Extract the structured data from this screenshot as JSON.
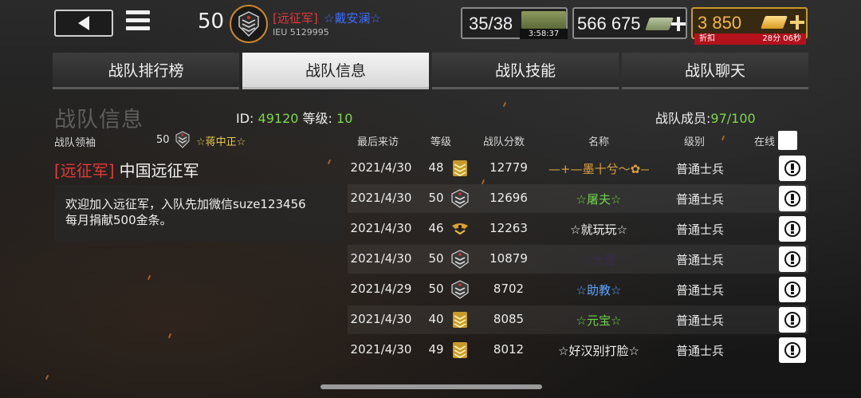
{
  "topbar": {
    "level": "50",
    "clan_tag": "[远征军]",
    "player_name": "☆戴安澜☆",
    "player_id": "IEU 5129995",
    "energy": "35/38",
    "energy_timer": "3:58:37",
    "silver": "566 675",
    "gold": "3 850",
    "discount_label": "折扣",
    "discount_time": "28分 06秒"
  },
  "tabs": [
    {
      "label": "战队排行榜"
    },
    {
      "label": "战队信息"
    },
    {
      "label": "战队技能"
    },
    {
      "label": "战队聊天"
    }
  ],
  "panel": {
    "section_title": "战队信息",
    "id_label": "ID:",
    "id_value": "49120",
    "level_label": "等级:",
    "level_value": "10",
    "members_label": "战队成员:",
    "members_value": "97/100",
    "leader_label": "战队领袖",
    "leader_level": "50",
    "leader_name": "☆蒋中正☆",
    "clan_tag": "[远征军]",
    "clan_name": "中国远征军",
    "notice_line1": "欢迎加入远征军，入队先加微信suze123456",
    "notice_line2": "每月捐献500金条。"
  },
  "table": {
    "headers": {
      "last_visit": "最后来访",
      "level": "等级",
      "score": "战队分数",
      "name": "名称",
      "rank": "级别",
      "online": "在线"
    },
    "rows": [
      {
        "date": "2021/4/30",
        "level": "48",
        "score": "12779",
        "name": "—+—墨十兮〜✿—☆",
        "role": "普通士兵",
        "name_color": "#d8a040",
        "rank_icon": "gold-chevron-icon"
      },
      {
        "date": "2021/4/30",
        "level": "50",
        "score": "12696",
        "name": "☆屠夫☆",
        "role": "普通士兵",
        "name_color": "#6fd24a",
        "rank_icon": "silver-star-icon"
      },
      {
        "date": "2021/4/30",
        "level": "46",
        "score": "12263",
        "name": "☆就玩玩☆",
        "role": "普通士兵",
        "name_color": "#f0f0f0",
        "rank_icon": "gold-eagle-icon"
      },
      {
        "date": "2021/4/30",
        "level": "50",
        "score": "10879",
        "name": "☆大佬",
        "role": "普通士兵",
        "name_color": "#3a2b4a",
        "rank_icon": "silver-star-icon"
      },
      {
        "date": "2021/4/29",
        "level": "50",
        "score": "8702",
        "name": "☆助教☆",
        "role": "普通士兵",
        "name_color": "#5aa7ff",
        "rank_icon": "silver-star-icon"
      },
      {
        "date": "2021/4/30",
        "level": "40",
        "score": "8085",
        "name": "☆元宝☆",
        "role": "普通士兵",
        "name_color": "#6fd24a",
        "rank_icon": "gold-chevron-icon"
      },
      {
        "date": "2021/4/30",
        "level": "49",
        "score": "8012",
        "name": "☆好汉别打脸☆",
        "role": "普通士兵",
        "name_color": "#f0f0f0",
        "rank_icon": "gold-chevron-icon"
      }
    ]
  },
  "colors": {
    "accent_red": "#e23a3a",
    "accent_green": "#7dd64c",
    "gold": "#f0b84a"
  }
}
